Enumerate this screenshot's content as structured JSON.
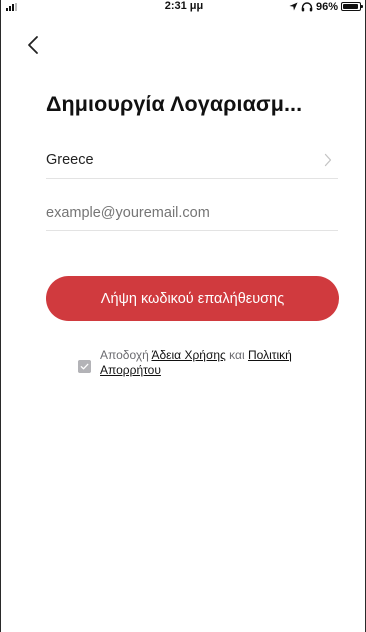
{
  "status_bar": {
    "time": "2:31 μμ",
    "battery_percent": "96%",
    "battery_level": 0.96,
    "icons": [
      "signal-icon",
      "location-arrow-icon",
      "headphones-icon",
      "battery-icon"
    ]
  },
  "header": {
    "back_icon": "chevron-left-icon",
    "title": "Δημιουργία Λογαριασμ..."
  },
  "form": {
    "country": "Greece",
    "country_icon": "chevron-right-icon",
    "email_placeholder": "example@youremail.com",
    "email_value": ""
  },
  "actions": {
    "verify_label": "Λήψη κωδικού επαλήθευσης",
    "verify_color": "#d03a3e"
  },
  "agreement": {
    "prefix": "Αποδοχή",
    "license_link": "Άδεια Χρήσης",
    "conjunction": "και",
    "privacy_link": "Πολιτική Απορρήτου",
    "checked": true
  }
}
